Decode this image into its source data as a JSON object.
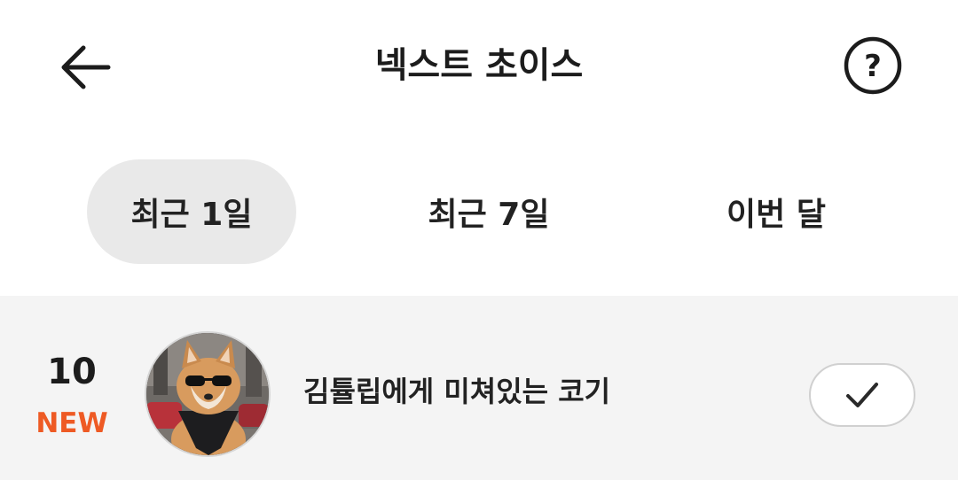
{
  "header": {
    "title": "넥스트 초이스",
    "back_icon": "arrow-left-icon",
    "help_icon": "question-circle-icon"
  },
  "tabs": [
    {
      "label": "최근 1일",
      "active": true
    },
    {
      "label": "최근 7일",
      "active": false
    },
    {
      "label": "이번 달",
      "active": false
    }
  ],
  "list": {
    "items": [
      {
        "rank": "10",
        "badge": "NEW",
        "title": "김튤립에게 미쳐있는 코기",
        "avatar": "corgi-with-sunglasses-image",
        "action_icon": "check-icon"
      }
    ]
  },
  "colors": {
    "accent": "#ee5a24",
    "tab_active_bg": "#e9e9e9",
    "list_bg": "#f4f4f4"
  }
}
